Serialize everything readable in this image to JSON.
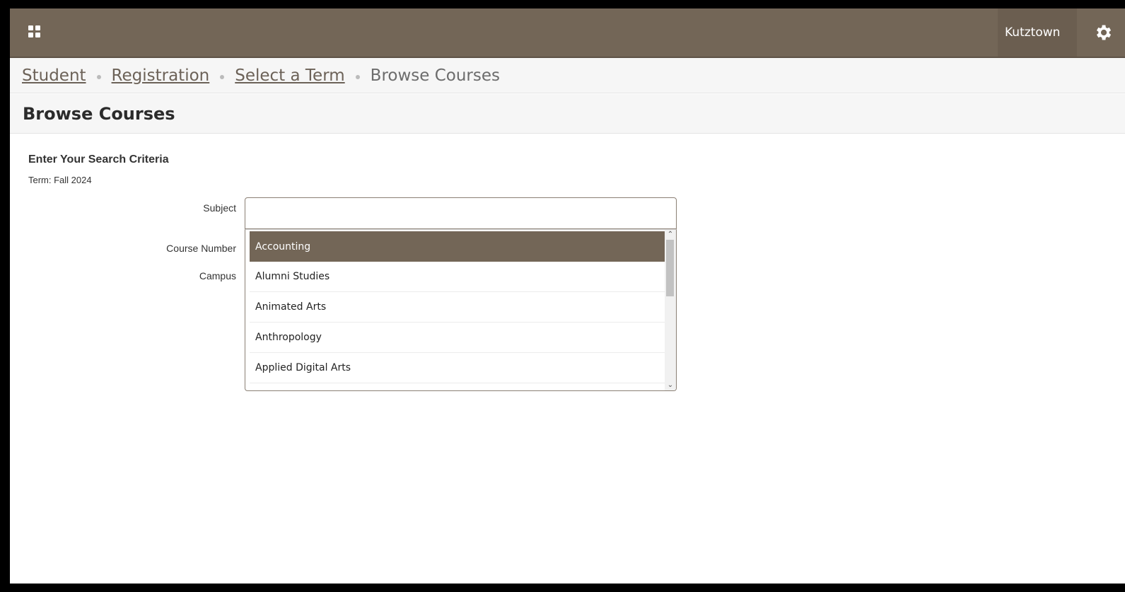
{
  "header": {
    "institution": "Kutztown",
    "icons": {
      "menu": "apps-grid-icon",
      "settings": "gear-icon"
    },
    "colors": {
      "bar": "#736657",
      "accent": "#736657"
    }
  },
  "breadcrumb": {
    "items": [
      "Student",
      "Registration",
      "Select a Term"
    ],
    "current": "Browse Courses"
  },
  "page": {
    "title": "Browse Courses"
  },
  "search": {
    "heading": "Enter Your Search Criteria",
    "term": "Term: Fall 2024",
    "labels": {
      "subject": "Subject",
      "course_number": "Course Number",
      "campus": "Campus"
    },
    "subject_value": "",
    "subject_options": [
      "Accounting",
      "Alumni Studies",
      "Animated Arts",
      "Anthropology",
      "Applied Digital Arts"
    ],
    "selected_option": "Accounting"
  }
}
